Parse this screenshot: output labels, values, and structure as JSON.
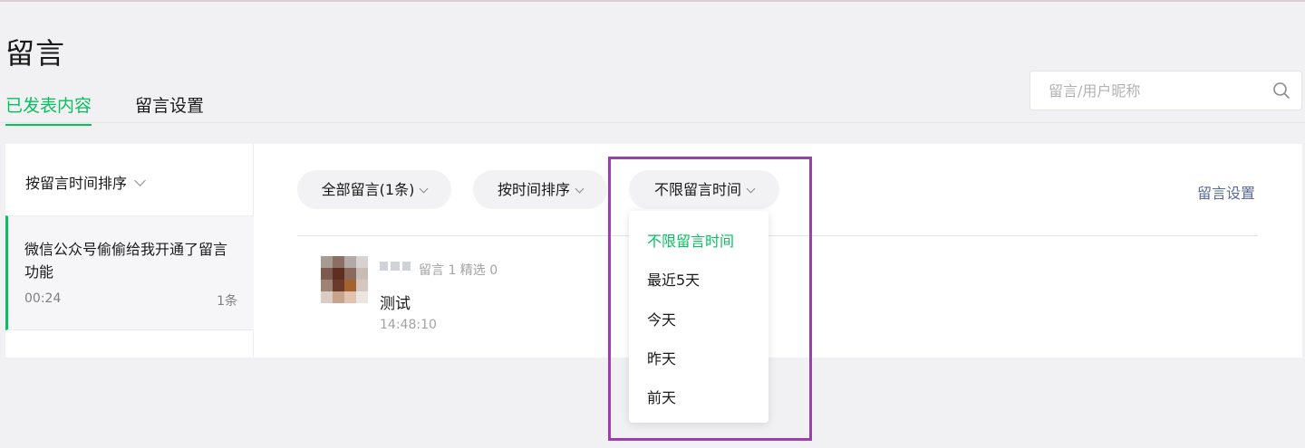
{
  "page": {
    "title": "留言"
  },
  "tabs": [
    {
      "label": "已发表内容",
      "active": true
    },
    {
      "label": "留言设置",
      "active": false
    }
  ],
  "search": {
    "placeholder": "留言/用户昵称",
    "value": ""
  },
  "sidebar": {
    "sort_label": "按留言时间排序",
    "articles": [
      {
        "title": "微信公众号偷偷给我开通了留言功能",
        "time": "00:24",
        "count": "1条",
        "selected": true
      }
    ]
  },
  "filters": {
    "all_label": "全部留言(1条)",
    "sort_label": "按时间排序",
    "time_label": "不限留言时间",
    "settings_link": "留言设置"
  },
  "comment": {
    "meta": "留言 1 精选 0",
    "text": "测试",
    "time": "14:48:10"
  },
  "time_dropdown": {
    "options": [
      "不限留言时间",
      "最近5天",
      "今天",
      "昨天",
      "前天"
    ],
    "selected_index": 0
  },
  "colors": {
    "accent": "#07c160",
    "link": "#576b95",
    "highlight": "#9b3fb0"
  }
}
